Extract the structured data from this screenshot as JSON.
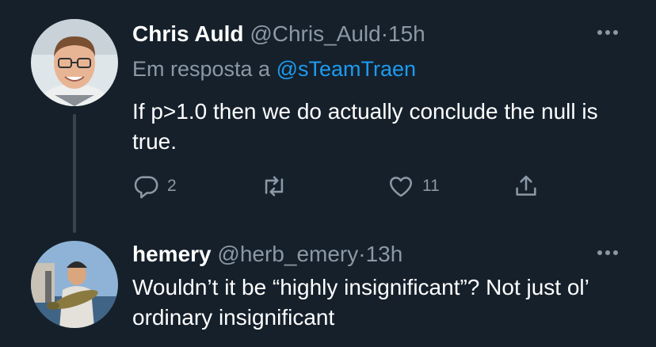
{
  "tweet1": {
    "name": "Chris Auld",
    "handle": "@Chris_Auld",
    "separator": "·",
    "time": "15h",
    "reply_prefix": "Em resposta a",
    "reply_mention": "@sTeamTraen",
    "text": "If p>1.0 then we do actually conclude the null is true.",
    "reply_count": "2",
    "like_count": "11"
  },
  "tweet2": {
    "name": "hemery",
    "handle": "@herb_emery",
    "separator": "·",
    "time": "13h",
    "text": "Wouldn’t it be “highly insignificant”? Not just ol’ ordinary insignificant"
  },
  "colors": {
    "background": "#15202b",
    "secondary_text": "#8b98a5",
    "link": "#1d9bf0",
    "thread_line": "#38444d"
  },
  "icons": [
    "reply-icon",
    "retweet-icon",
    "like-icon",
    "share-icon",
    "more-icon"
  ]
}
